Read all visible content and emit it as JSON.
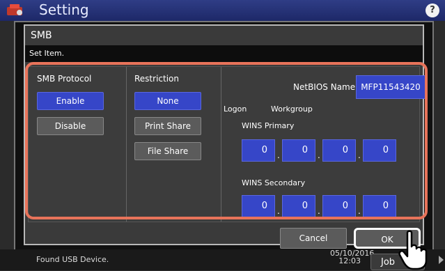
{
  "app": {
    "title": "Setting",
    "help_label": "?"
  },
  "dialog": {
    "title": "SMB",
    "subtitle": "Set Item.",
    "smb_protocol": {
      "label": "SMB Protocol",
      "enable": "Enable",
      "disable": "Disable",
      "selected": "Enable"
    },
    "restriction": {
      "label": "Restriction",
      "none": "None",
      "print_share": "Print Share",
      "file_share": "File Share",
      "selected": "None"
    },
    "netbios": {
      "label": "NetBIOS Name",
      "value": "MFP11543420"
    },
    "logon": {
      "label": "Logon",
      "value": "Workgroup"
    },
    "wins_primary": {
      "label": "WINS Primary",
      "octets": [
        "0",
        "0",
        "0",
        "0"
      ]
    },
    "wins_secondary": {
      "label": "WINS Secondary",
      "octets": [
        "0",
        "0",
        "0",
        "0"
      ]
    },
    "cancel_label": "Cancel",
    "ok_label": "OK"
  },
  "status": {
    "message": "Found USB Device.",
    "date": "05/10/2016",
    "time": "12:03",
    "job_label": "Job"
  },
  "colors": {
    "accent_blue": "#3646c8",
    "highlight": "#e8735a"
  }
}
